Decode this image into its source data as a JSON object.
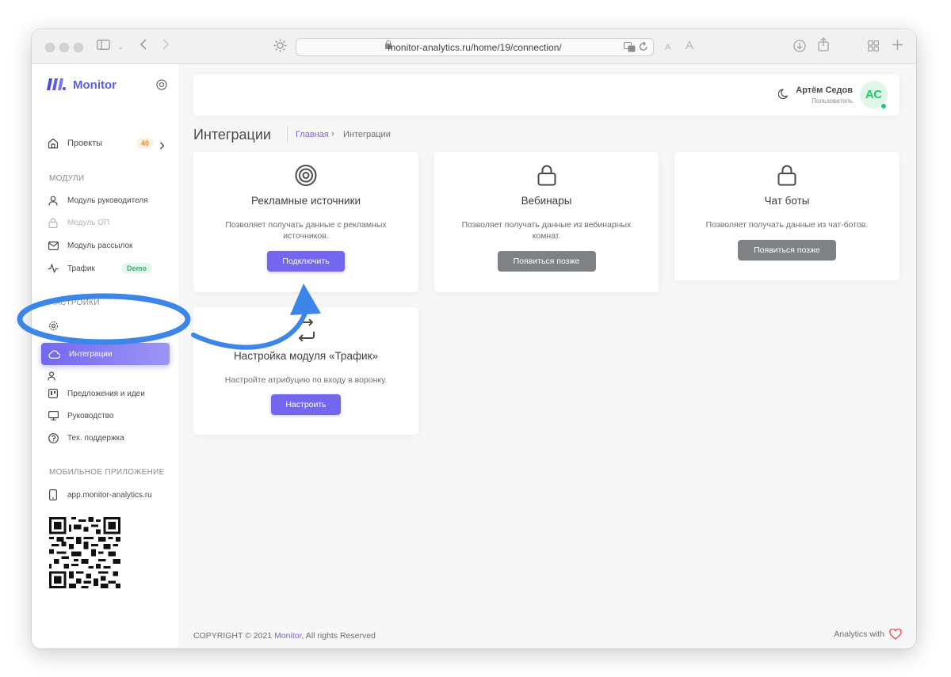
{
  "browser": {
    "url": "monitor-analytics.ru/home/19/connection/",
    "font_small": "A",
    "font_large": "A"
  },
  "sidebar": {
    "brand": "Monitor",
    "projects": {
      "label": "Проекты",
      "count": "40"
    },
    "sections": {
      "modules": "МОДУЛИ",
      "settings": "НАСТРОЙКИ",
      "mobile": "МОБИЛЬНОЕ ПРИЛОЖЕНИЕ"
    },
    "modules": [
      {
        "label": "Модуль руководителя",
        "icon": "user-icon",
        "disabled": false
      },
      {
        "label": "Модуль ОП",
        "icon": "lock-icon",
        "disabled": true
      },
      {
        "label": "Модуль рассылок",
        "icon": "mail-icon",
        "disabled": false
      },
      {
        "label": "Трафик",
        "icon": "activity-icon",
        "badge": "Demo"
      }
    ],
    "settings_items": [
      {
        "label": "Интеграции",
        "icon": "cloud-icon",
        "active": true
      },
      {
        "label": "Предложения и идеи",
        "icon": "board-icon"
      },
      {
        "label": "Руководство",
        "icon": "monitor-icon"
      },
      {
        "label": "Тех. поддержка",
        "icon": "help-icon"
      }
    ],
    "mobile_link": "app.monitor-analytics.ru"
  },
  "header": {
    "user_name": "Артём Седов",
    "user_role": "Пользователь",
    "avatar_initials": "АС"
  },
  "page": {
    "title": "Интеграции",
    "breadcrumb_home": "Главная",
    "breadcrumb_sep": "›",
    "breadcrumb_current": "Интеграции"
  },
  "cards": [
    {
      "title": "Рекламные источники",
      "description": "Позволяет получать данные с рекламных источников.",
      "button": "Подключить",
      "icon": "target-icon",
      "button_style": "primary"
    },
    {
      "title": "Вебинары",
      "description": "Позволяет получать данные из вебинарных комнат.",
      "button": "Появиться позже",
      "icon": "lock-icon",
      "button_style": "gray"
    },
    {
      "title": "Чат боты",
      "description": "Позволяет получать данные из чат-ботов.",
      "button": "Появиться позже",
      "icon": "lock-icon",
      "button_style": "gray"
    },
    {
      "title": "Настройка модуля «Трафик»",
      "description": "Настройте атрибуцию по входу в воронку.",
      "button": "Настроить",
      "icon": "transfer-icon",
      "button_style": "primary"
    }
  ],
  "footer": {
    "copyright_prefix": "COPYRIGHT © 2021 ",
    "copyright_brand": "Monitor",
    "copyright_suffix": ", All rights Reserved",
    "right_text": "Analytics with"
  },
  "colors": {
    "accent": "#7367f0",
    "brand": "#5b5fe6",
    "success": "#28c76f",
    "warning": "#f08a2b",
    "annotation": "#3b86e8"
  }
}
